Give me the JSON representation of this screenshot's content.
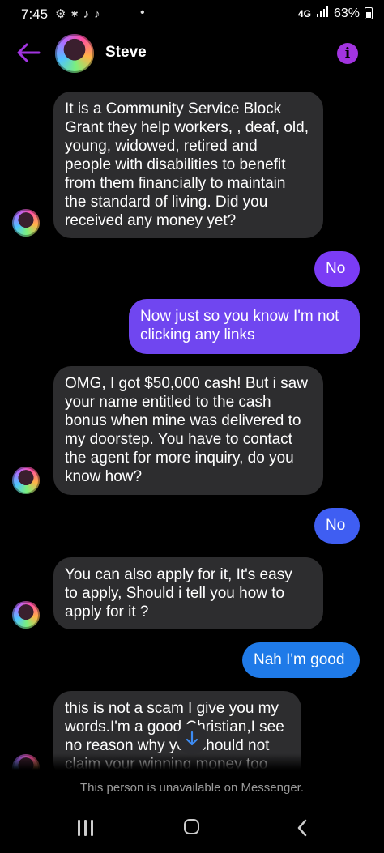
{
  "status_bar": {
    "time": "7:45",
    "battery": "63%",
    "network": "4G"
  },
  "header": {
    "contact_name": "Steve"
  },
  "colors": {
    "accent": "#a234e0",
    "incoming_bubble": "#2d2d2f",
    "outgoing_gradient": [
      "#7b3cf5",
      "#4a56f3",
      "#1f7ae8"
    ]
  },
  "messages": [
    {
      "direction": "incoming",
      "text": "It is a Community Service Block\nGrant they help workers, , deaf, old,\nyoung, widowed, retired and\npeople with disabilities to benefit\nfrom them financially to maintain\nthe standard of living. Did you\nreceived any money yet?"
    },
    {
      "direction": "outgoing",
      "text": "No"
    },
    {
      "direction": "outgoing",
      "text": "Now just so you know I'm not\nclicking any links"
    },
    {
      "direction": "incoming",
      "text": "OMG, I got $50,000 cash! But i saw\nyour name entitled to the cash\nbonus when mine was delivered to\nmy doorstep. You have to contact\nthe agent for more inquiry, do you\nknow how?"
    },
    {
      "direction": "outgoing",
      "text": "No"
    },
    {
      "direction": "incoming",
      "text": "You can also apply for it, It's easy\nto apply, Should i tell you how to\napply for it ?"
    },
    {
      "direction": "outgoing",
      "text": "Nah I'm good"
    },
    {
      "direction": "incoming",
      "text": "this is not a scam I give you my\nwords.I'm a good Christian,I see\nno reason why you should not\nclaim your winning money too"
    }
  ],
  "footer": {
    "unavailable_text": "This person is unavailable on Messenger."
  }
}
